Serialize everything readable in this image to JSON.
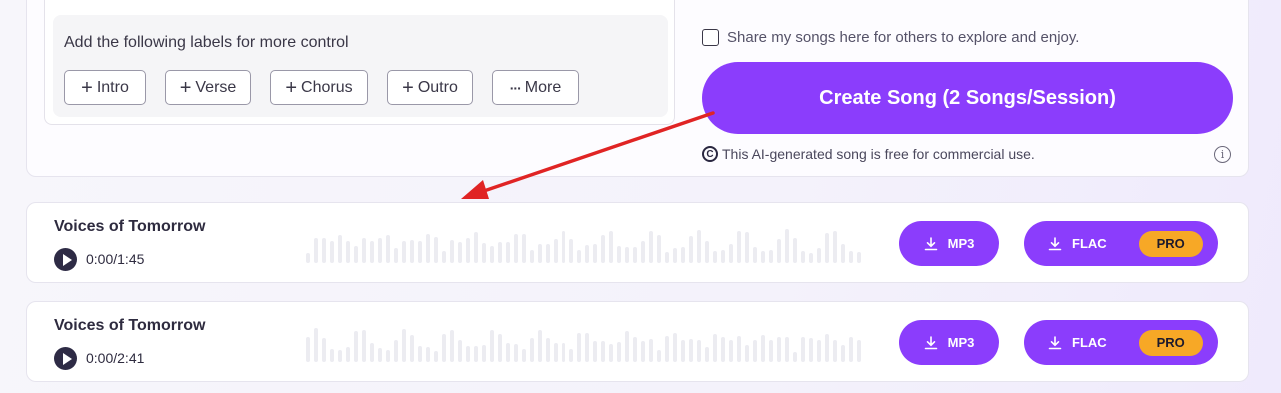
{
  "labels_panel": {
    "title": "Add the following labels for more control",
    "buttons": [
      {
        "label": "Intro",
        "icon": "plus-icon"
      },
      {
        "label": "Verse",
        "icon": "plus-icon"
      },
      {
        "label": "Chorus",
        "icon": "plus-icon"
      },
      {
        "label": "Outro",
        "icon": "plus-icon"
      },
      {
        "label": "More",
        "icon": "ellipsis-icon"
      }
    ]
  },
  "share": {
    "checked": false,
    "label": "Share my songs here for others to explore and enjoy."
  },
  "create_button": {
    "label": "Create Song (2 Songs/Session)",
    "color": "#8b3dfc"
  },
  "license_note": {
    "icon": "copyright-icon",
    "text": "This AI-generated song is free for commercial use.",
    "info_icon": "info-icon"
  },
  "songs": [
    {
      "title": "Voices of Tomorrow",
      "time": "0:00/1:45",
      "mp3_label": "MP3",
      "flac_label": "FLAC",
      "pro_badge": "PRO"
    },
    {
      "title": "Voices of Tomorrow",
      "time": "0:00/2:41",
      "mp3_label": "MP3",
      "flac_label": "FLAC",
      "pro_badge": "PRO"
    }
  ],
  "colors": {
    "accent": "#8b3dfc",
    "pro_badge": "#f7a826",
    "annotation_arrow": "#e02424"
  }
}
